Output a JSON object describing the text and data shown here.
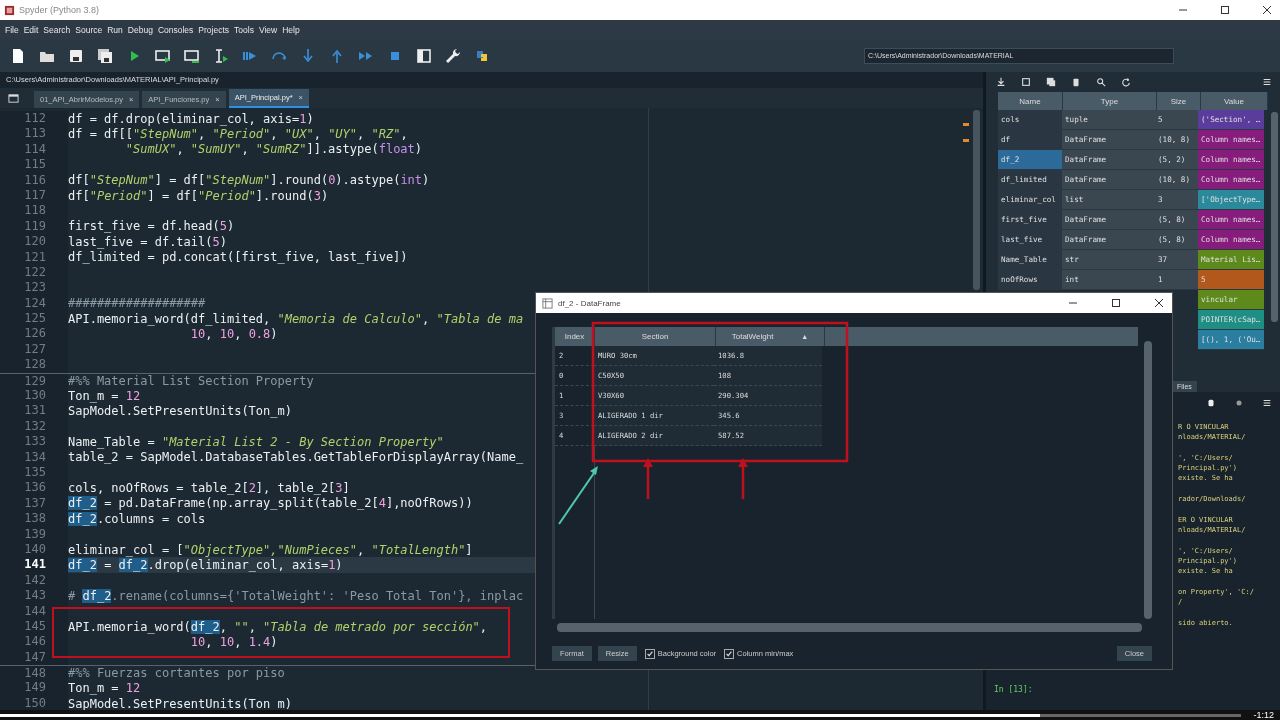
{
  "window": {
    "title": "Spyder (Python 3.8)"
  },
  "menu": [
    "File",
    "Edit",
    "Search",
    "Source",
    "Run",
    "Debug",
    "Consoles",
    "Projects",
    "Tools",
    "View",
    "Help"
  ],
  "toolbar": {
    "working_dir": "C:\\Users\\Administrador\\Downloads\\MATERIAL"
  },
  "file_path": "C:\\Users\\Administrador\\Downloads\\MATERIAL\\API_Principal.py",
  "tabs": [
    {
      "label": "01_API_AbrirModelos.py",
      "close": "×",
      "selected": false
    },
    {
      "label": "API_Funciones.py",
      "close": "×",
      "selected": false
    },
    {
      "label": "API_Principal.py*",
      "close": "×",
      "selected": true
    }
  ],
  "editor": {
    "lines": [
      {
        "num": "112",
        "kind": "code",
        "current": false,
        "parts": [
          {
            "text": "df = df.drop(eliminar_col, axis=",
            "kind": "plain"
          },
          {
            "text": "1",
            "kind": "num"
          },
          {
            "text": ")",
            "kind": "plain"
          }
        ]
      },
      {
        "num": "113",
        "kind": "code",
        "current": false,
        "parts": [
          {
            "text": "df = df[[",
            "kind": "plain"
          },
          {
            "text": "\"StepNum\"",
            "kind": "str"
          },
          {
            "text": ", ",
            "kind": "plain"
          },
          {
            "text": "\"Period\"",
            "kind": "str"
          },
          {
            "text": ", ",
            "kind": "plain"
          },
          {
            "text": "\"UX\"",
            "kind": "str"
          },
          {
            "text": ", ",
            "kind": "plain"
          },
          {
            "text": "\"UY\"",
            "kind": "str"
          },
          {
            "text": ", ",
            "kind": "plain"
          },
          {
            "text": "\"RZ\"",
            "kind": "str"
          },
          {
            "text": ",",
            "kind": "plain"
          }
        ]
      },
      {
        "num": "114",
        "kind": "code",
        "current": false,
        "parts": [
          {
            "text": "        \"SumUX\"",
            "kind": "str"
          },
          {
            "text": ", ",
            "kind": "plain"
          },
          {
            "text": "\"SumUY\"",
            "kind": "str"
          },
          {
            "text": ", ",
            "kind": "plain"
          },
          {
            "text": "\"SumRZ\"",
            "kind": "str"
          },
          {
            "text": "]].astype(",
            "kind": "plain"
          },
          {
            "text": "float",
            "kind": "builtin"
          },
          {
            "text": ")",
            "kind": "plain"
          }
        ]
      },
      {
        "num": "115",
        "kind": "code",
        "current": false
      },
      {
        "num": "116",
        "kind": "code",
        "current": false,
        "parts": [
          {
            "text": "df[",
            "kind": "plain"
          },
          {
            "text": "\"StepNum\"",
            "kind": "str"
          },
          {
            "text": "] = df[",
            "kind": "plain"
          },
          {
            "text": "\"StepNum\"",
            "kind": "str"
          },
          {
            "text": "].round(",
            "kind": "plain"
          },
          {
            "text": "0",
            "kind": "num"
          },
          {
            "text": ").astype(",
            "kind": "plain"
          },
          {
            "text": "int",
            "kind": "builtin"
          },
          {
            "text": ")",
            "kind": "plain"
          }
        ]
      },
      {
        "num": "117",
        "kind": "code",
        "current": false,
        "parts": [
          {
            "text": "df[",
            "kind": "plain"
          },
          {
            "text": "\"Period\"",
            "kind": "str"
          },
          {
            "text": "] = df[",
            "kind": "plain"
          },
          {
            "text": "\"Period\"",
            "kind": "str"
          },
          {
            "text": "].round(",
            "kind": "plain"
          },
          {
            "text": "3",
            "kind": "num"
          },
          {
            "text": ")",
            "kind": "plain"
          }
        ]
      },
      {
        "num": "118",
        "kind": "code",
        "current": false
      },
      {
        "num": "119",
        "kind": "code",
        "current": false,
        "parts": [
          {
            "text": "first_five = df.head(",
            "kind": "plain"
          },
          {
            "text": "5",
            "kind": "num"
          },
          {
            "text": ")",
            "kind": "plain"
          }
        ]
      },
      {
        "num": "120",
        "kind": "code",
        "current": false,
        "parts": [
          {
            "text": "last_five = df.tail(",
            "kind": "plain"
          },
          {
            "text": "5",
            "kind": "num"
          },
          {
            "text": ")",
            "kind": "plain"
          }
        ]
      },
      {
        "num": "121",
        "kind": "code",
        "current": false,
        "parts": [
          {
            "text": "df_limited = pd.concat([first_five, last_five])",
            "kind": "plain"
          }
        ]
      },
      {
        "num": "122",
        "kind": "code",
        "current": false
      },
      {
        "num": "123",
        "kind": "code",
        "current": false
      },
      {
        "num": "124",
        "kind": "code",
        "current": false,
        "parts": [
          {
            "text": "###################",
            "kind": "comment"
          }
        ]
      },
      {
        "num": "125",
        "kind": "code",
        "current": false,
        "parts": [
          {
            "text": "API.memoria_word(df_limited, ",
            "kind": "plain"
          },
          {
            "text": "\"Memoria de Calculo\"",
            "kind": "str"
          },
          {
            "text": ", ",
            "kind": "plain"
          },
          {
            "text": "\"Tabla de ma",
            "kind": "str"
          }
        ]
      },
      {
        "num": "126",
        "kind": "code",
        "current": false,
        "parts": [
          {
            "text": "                 10",
            "kind": "num"
          },
          {
            "text": ", ",
            "kind": "plain"
          },
          {
            "text": "10",
            "kind": "num"
          },
          {
            "text": ", ",
            "kind": "plain"
          },
          {
            "text": "0.8",
            "kind": "num"
          },
          {
            "text": ")",
            "kind": "plain"
          }
        ]
      },
      {
        "num": "127",
        "kind": "code",
        "current": false
      },
      {
        "num": "128",
        "kind": "code",
        "current": false
      },
      {
        "num": "129",
        "kind": "cell",
        "current": false,
        "parts": [
          {
            "text": "#%% Material List Section Property",
            "kind": "comment"
          }
        ]
      },
      {
        "num": "130",
        "kind": "code",
        "current": false,
        "parts": [
          {
            "text": "Ton_m = ",
            "kind": "plain"
          },
          {
            "text": "12",
            "kind": "num"
          }
        ]
      },
      {
        "num": "131",
        "kind": "code",
        "current": false,
        "parts": [
          {
            "text": "SapModel.SetPresentUnits(Ton_m)",
            "kind": "plain"
          }
        ]
      },
      {
        "num": "132",
        "kind": "code",
        "current": false
      },
      {
        "num": "133",
        "kind": "code",
        "current": false,
        "parts": [
          {
            "text": "Name_Table = ",
            "kind": "plain"
          },
          {
            "text": "\"Material List 2 - By Section Property\"",
            "kind": "str"
          }
        ]
      },
      {
        "num": "134",
        "kind": "code",
        "current": false,
        "parts": [
          {
            "text": "table_2 = SapModel.DatabaseTables.GetTableForDisplayArray(Name_",
            "kind": "plain"
          }
        ]
      },
      {
        "num": "135",
        "kind": "code",
        "current": false
      },
      {
        "num": "136",
        "kind": "code",
        "current": false,
        "parts": [
          {
            "text": "cols, noOfRows = table_2[",
            "kind": "plain"
          },
          {
            "text": "2",
            "kind": "num"
          },
          {
            "text": "], table_2[",
            "kind": "plain"
          },
          {
            "text": "3",
            "kind": "num"
          },
          {
            "text": "]",
            "kind": "plain"
          }
        ]
      },
      {
        "num": "137",
        "kind": "code",
        "current": false,
        "parts": [
          {
            "text": "df_2",
            "kind": "hl"
          },
          {
            "text": " = pd.DataFrame(np.array_split(table_2[",
            "kind": "plain"
          },
          {
            "text": "4",
            "kind": "num"
          },
          {
            "text": "],noOfRows))",
            "kind": "plain"
          }
        ]
      },
      {
        "num": "138",
        "kind": "code",
        "current": false,
        "parts": [
          {
            "text": "df_2",
            "kind": "hl"
          },
          {
            "text": ".columns = cols",
            "kind": "plain"
          }
        ]
      },
      {
        "num": "139",
        "kind": "code",
        "current": false
      },
      {
        "num": "140",
        "kind": "code",
        "current": false,
        "parts": [
          {
            "text": "eliminar_col = [",
            "kind": "plain"
          },
          {
            "text": "\"ObjectType\",\"NumPieces\"",
            "kind": "str"
          },
          {
            "text": ", ",
            "kind": "plain"
          },
          {
            "text": "\"TotalLength\"",
            "kind": "str"
          },
          {
            "text": "]",
            "kind": "plain"
          }
        ]
      },
      {
        "num": "141",
        "kind": "code",
        "current": true,
        "parts": [
          {
            "text": "df_2",
            "kind": "hl"
          },
          {
            "text": " = ",
            "kind": "plain"
          },
          {
            "text": "df_2",
            "kind": "hl"
          },
          {
            "text": ".drop(eliminar_col, axis=",
            "kind": "plain"
          },
          {
            "text": "1",
            "kind": "num"
          },
          {
            "text": ")",
            "kind": "plain"
          }
        ]
      },
      {
        "num": "142",
        "kind": "code",
        "current": false
      },
      {
        "num": "143",
        "kind": "code",
        "current": false,
        "parts": [
          {
            "text": "# ",
            "kind": "comment"
          },
          {
            "text": "df_2",
            "kind": "hl"
          },
          {
            "text": ".rename(columns={'TotalWeight': 'Peso Total Ton'}, inplac",
            "kind": "comment"
          }
        ]
      },
      {
        "num": "144",
        "kind": "code",
        "current": false
      },
      {
        "num": "145",
        "kind": "code",
        "current": false,
        "parts": [
          {
            "text": "API.memoria_word(",
            "kind": "plain"
          },
          {
            "text": "df_2",
            "kind": "hl"
          },
          {
            "text": ", ",
            "kind": "plain"
          },
          {
            "text": "\"\"",
            "kind": "str"
          },
          {
            "text": ", ",
            "kind": "plain"
          },
          {
            "text": "\"Tabla de metrado por sección\"",
            "kind": "str"
          },
          {
            "text": ",",
            "kind": "plain"
          }
        ]
      },
      {
        "num": "146",
        "kind": "code",
        "current": false,
        "parts": [
          {
            "text": "                 10",
            "kind": "num"
          },
          {
            "text": ", ",
            "kind": "plain"
          },
          {
            "text": "10",
            "kind": "num"
          },
          {
            "text": ", ",
            "kind": "plain"
          },
          {
            "text": "1.4",
            "kind": "num"
          },
          {
            "text": ")",
            "kind": "plain"
          }
        ]
      },
      {
        "num": "147",
        "kind": "code",
        "current": false
      },
      {
        "num": "148",
        "kind": "cell",
        "current": false,
        "parts": [
          {
            "text": "#%% Fuerzas cortantes por piso",
            "kind": "comment"
          }
        ]
      },
      {
        "num": "149",
        "kind": "code",
        "current": false,
        "parts": [
          {
            "text": "Ton_m = ",
            "kind": "plain"
          },
          {
            "text": "12",
            "kind": "num"
          }
        ]
      },
      {
        "num": "150",
        "kind": "code",
        "current": false,
        "parts": [
          {
            "text": "SapModel.SetPresentUnits(Ton_m)",
            "kind": "plain"
          }
        ]
      }
    ]
  },
  "variable_explorer": {
    "columns": [
      "Name",
      "Type",
      "Size",
      "Value"
    ],
    "rows": [
      {
        "name": "cols",
        "type": "tuple",
        "size": "5",
        "value": "('Section', …",
        "color": "#5a3c9c",
        "selected": false
      },
      {
        "name": "df",
        "type": "DataFrame",
        "size": "(10, 8)",
        "value": "Column names…",
        "color": "#861c7c",
        "selected": false
      },
      {
        "name": "df_2",
        "type": "DataFrame",
        "size": "(5, 2)",
        "value": "Column names…",
        "color": "#861c7c",
        "selected": true
      },
      {
        "name": "df_limited",
        "type": "DataFrame",
        "size": "(10, 8)",
        "value": "Column names…",
        "color": "#861c7c",
        "selected": false
      },
      {
        "name": "eliminar_col",
        "type": "list",
        "size": "3",
        "value": "['ObjectType…",
        "color": "#2a8a9c",
        "selected": false
      },
      {
        "name": "first_five",
        "type": "DataFrame",
        "size": "(5, 8)",
        "value": "Column names…",
        "color": "#861c7c",
        "selected": false
      },
      {
        "name": "last_five",
        "type": "DataFrame",
        "size": "(5, 8)",
        "value": "Column names…",
        "color": "#861c7c",
        "selected": false
      },
      {
        "name": "Name_Table",
        "type": "str",
        "size": "37",
        "value": "Material Lis…",
        "color": "#5e8a1c",
        "selected": false
      },
      {
        "name": "noOfRows",
        "type": "int",
        "size": "1",
        "value": "5",
        "color": "#b2581c",
        "selected": false
      },
      {
        "value": "vincular",
        "color": "#5e8a1c"
      },
      {
        "value": "POINTER(cSap…",
        "color": "#1f8f86"
      },
      {
        "value": "[(), 1, ('Ou…",
        "color": "#2a7fa0"
      }
    ]
  },
  "files_tab": "Files",
  "console": {
    "blocks": [
      [
        "R O VINCULAR",
        "nloads/MATERIAL/"
      ],
      [
        "', 'C:/Users/",
        "Principal.py')",
        "existe. Se ha"
      ],
      [
        "rador/Downloads/"
      ],
      [
        "ER O VINCULAR",
        "nloads/MATERIAL/"
      ],
      [
        "', 'C:/Users/",
        "Principal.py')",
        "existe. Se ha"
      ],
      [
        "on Property', 'C:/",
        "/"
      ],
      [
        "sido abierto."
      ]
    ],
    "prompt": "In [13]:"
  },
  "dataframe_dialog": {
    "title": "df_2 - DataFrame",
    "columns": [
      "Index",
      "Section",
      "TotalWeight"
    ],
    "sort_mark": "▲",
    "rows": [
      [
        "2",
        "MURO 30cm",
        "1036.8"
      ],
      [
        "0",
        "C50X50",
        "108"
      ],
      [
        "1",
        "V30X60",
        "290.304"
      ],
      [
        "3",
        "ALIGERADO 1 dir",
        "345.6"
      ],
      [
        "4",
        "ALIGERADO 2 dir",
        "587.52"
      ]
    ],
    "buttons": [
      "Format",
      "Resize"
    ],
    "checkboxes": [
      {
        "label": "Background color",
        "checked": true
      },
      {
        "label": "Column min/max",
        "checked": true
      }
    ],
    "close_button": "Close"
  },
  "video": {
    "level": 0.838,
    "remaining": "-1:12"
  }
}
